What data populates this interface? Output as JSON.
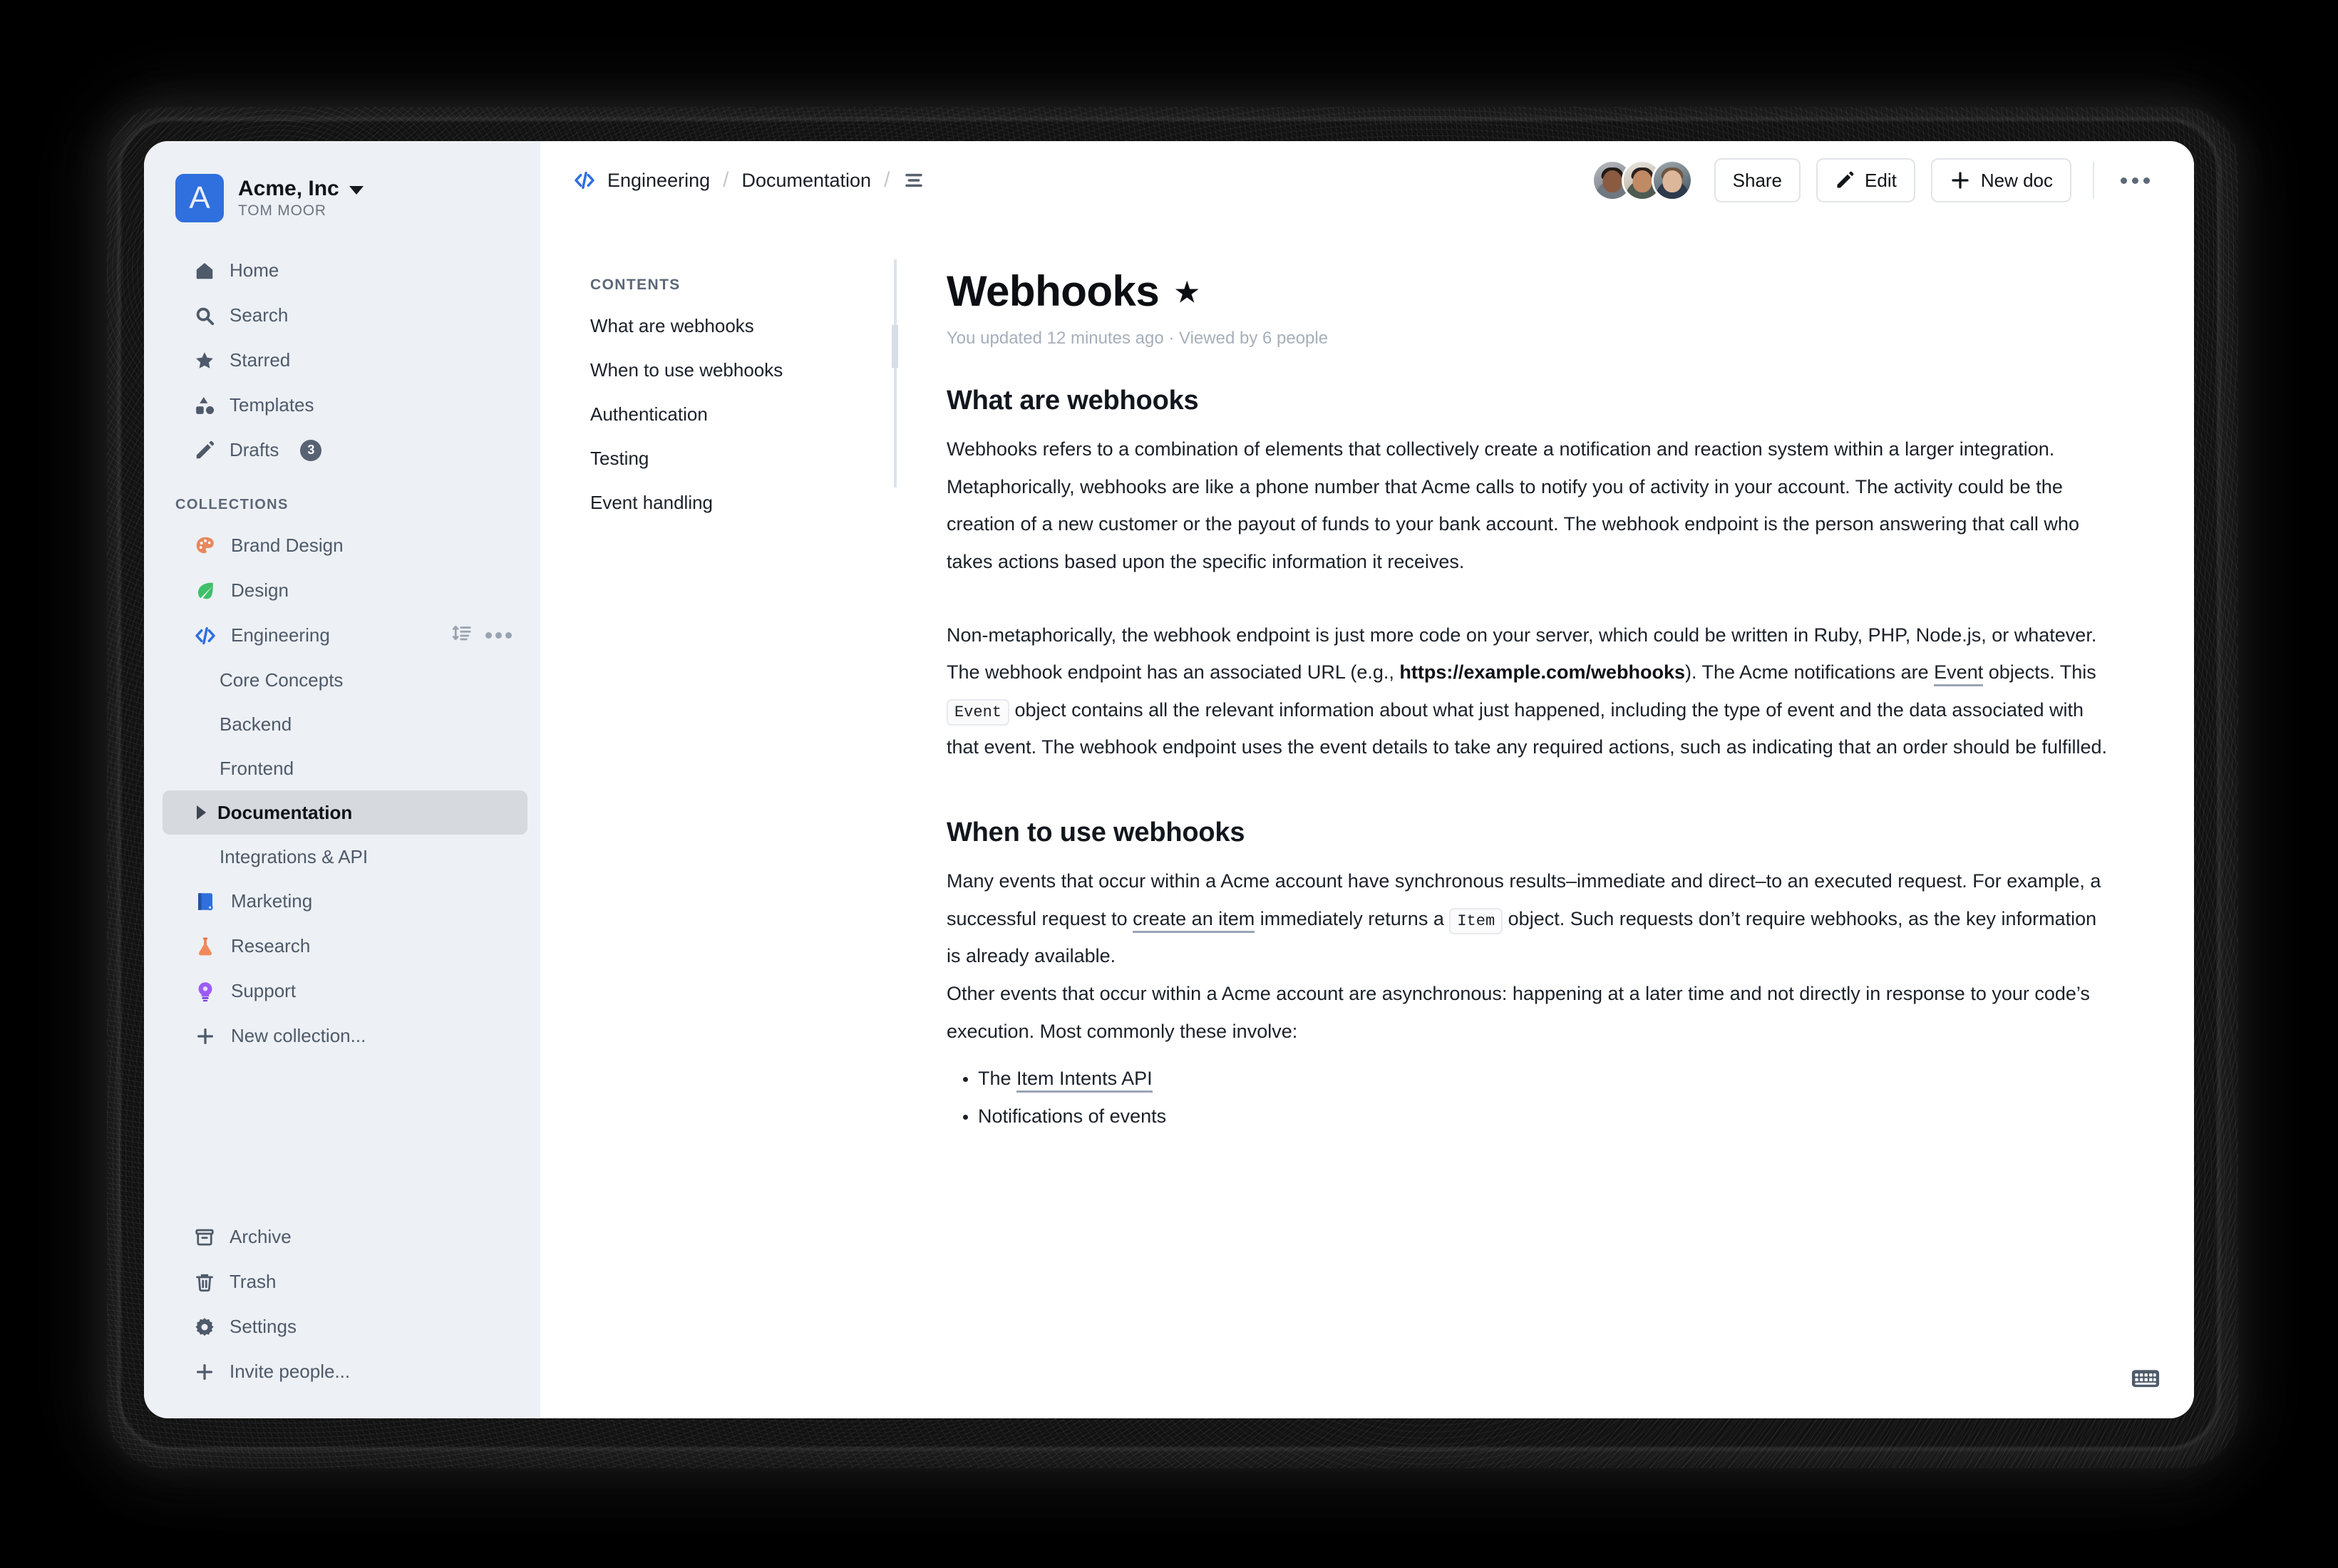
{
  "workspace": {
    "logo_letter": "A",
    "name": "Acme, Inc",
    "user": "TOM MOOR",
    "accent": "#2f6fde"
  },
  "sidebar": {
    "nav": [
      {
        "label": "Home",
        "icon": "home-icon"
      },
      {
        "label": "Search",
        "icon": "search-icon"
      },
      {
        "label": "Starred",
        "icon": "star-icon"
      },
      {
        "label": "Templates",
        "icon": "templates-icon"
      },
      {
        "label": "Drafts",
        "icon": "pencil-icon",
        "badge": "3"
      }
    ],
    "collections_label": "COLLECTIONS",
    "collections": [
      {
        "label": "Brand Design",
        "icon": "palette-icon",
        "color": "#e8865c"
      },
      {
        "label": "Design",
        "icon": "leaf-icon",
        "color": "#3fc06a"
      },
      {
        "label": "Engineering",
        "icon": "code-icon",
        "color": "#2f6fde",
        "active": true,
        "actions": [
          "sort-icon",
          "more-icon"
        ]
      },
      {
        "label": "Marketing",
        "icon": "book-icon",
        "color": "#2f6fde"
      },
      {
        "label": "Research",
        "icon": "flask-icon",
        "color": "#f08a5d"
      },
      {
        "label": "Support",
        "icon": "lightbulb-icon",
        "color": "#9b5cf6"
      }
    ],
    "engineering_docs": [
      {
        "label": "Core Concepts"
      },
      {
        "label": "Backend"
      },
      {
        "label": "Frontend"
      },
      {
        "label": "Documentation",
        "selected": true
      },
      {
        "label": "Integrations & API"
      }
    ],
    "new_collection": {
      "label": "New collection...",
      "icon": "plus-icon"
    },
    "footer": [
      {
        "label": "Archive",
        "icon": "archive-icon"
      },
      {
        "label": "Trash",
        "icon": "trash-icon"
      },
      {
        "label": "Settings",
        "icon": "gear-icon"
      },
      {
        "label": "Invite people...",
        "icon": "plus-icon"
      }
    ]
  },
  "topbar": {
    "breadcrumb": {
      "collection": "Engineering",
      "separator": "/",
      "document": "Documentation",
      "menu_icon": "hamburger-icon"
    },
    "share_label": "Share",
    "edit_label": "Edit",
    "new_doc_label": "New doc",
    "more_icon": "ellipsis-icon",
    "collaborators": 3
  },
  "toc": {
    "label": "CONTENTS",
    "items": [
      "What are webhooks",
      "When to use webhooks",
      "Authentication",
      "Testing",
      "Event handling"
    ]
  },
  "document": {
    "title": "Webhooks",
    "starred_icon": "star-filled-icon",
    "meta": "You updated 12 minutes ago · Viewed by 6 people",
    "sections": [
      {
        "heading": "What are webhooks",
        "paragraph_1": "Webhooks refers to a combination of elements that collectively create a notification and reaction system within a larger integration.",
        "paragraph_2": "Metaphorically, webhooks are like a phone number that Acme calls to notify you of activity in your account. The activity could be the creation of a new customer or the payout of funds to your bank account. The webhook endpoint is the person answering that call who takes actions based upon the specific information it receives.",
        "paragraph_3_part1": "Non-metaphorically, the webhook endpoint is just more code on your server, which could be written in Ruby, PHP, Node.js, or whatever. The webhook endpoint has an associated URL (e.g., ",
        "paragraph_3_url": "https://example.com/webhooks",
        "paragraph_3_part2": "). The Acme notifications are ",
        "paragraph_3_link": "Event",
        "paragraph_3_part3": " objects. This ",
        "paragraph_3_code": "Event",
        "paragraph_3_part4": " object contains all the relevant information about what just happened, including the type of event and the data associated with that event. The webhook endpoint uses the event details to take any required actions, such as indicating that an order should be fulfilled."
      },
      {
        "heading": "When to use webhooks",
        "paragraph_1_part1": "Many events that occur within a Acme account have synchronous results–immediate and direct–to an executed request. For example, a successful request to ",
        "paragraph_1_link": "create an item",
        "paragraph_1_part2": " immediately returns a ",
        "paragraph_1_code": "Item",
        "paragraph_1_part3": " object. Such requests don’t require webhooks, as the key information is already available.",
        "paragraph_2": "Other events that occur within a Acme account are asynchronous: happening at a later time and not directly in response to your code’s execution. Most commonly these involve:",
        "bullets": [
          {
            "prefix": "The ",
            "link": "Item Intents API",
            "suffix": ""
          },
          {
            "prefix": "Notifications of events",
            "link": "",
            "suffix": ""
          }
        ]
      }
    ]
  },
  "footer_controls": {
    "keyboard_icon": "keyboard-icon"
  }
}
